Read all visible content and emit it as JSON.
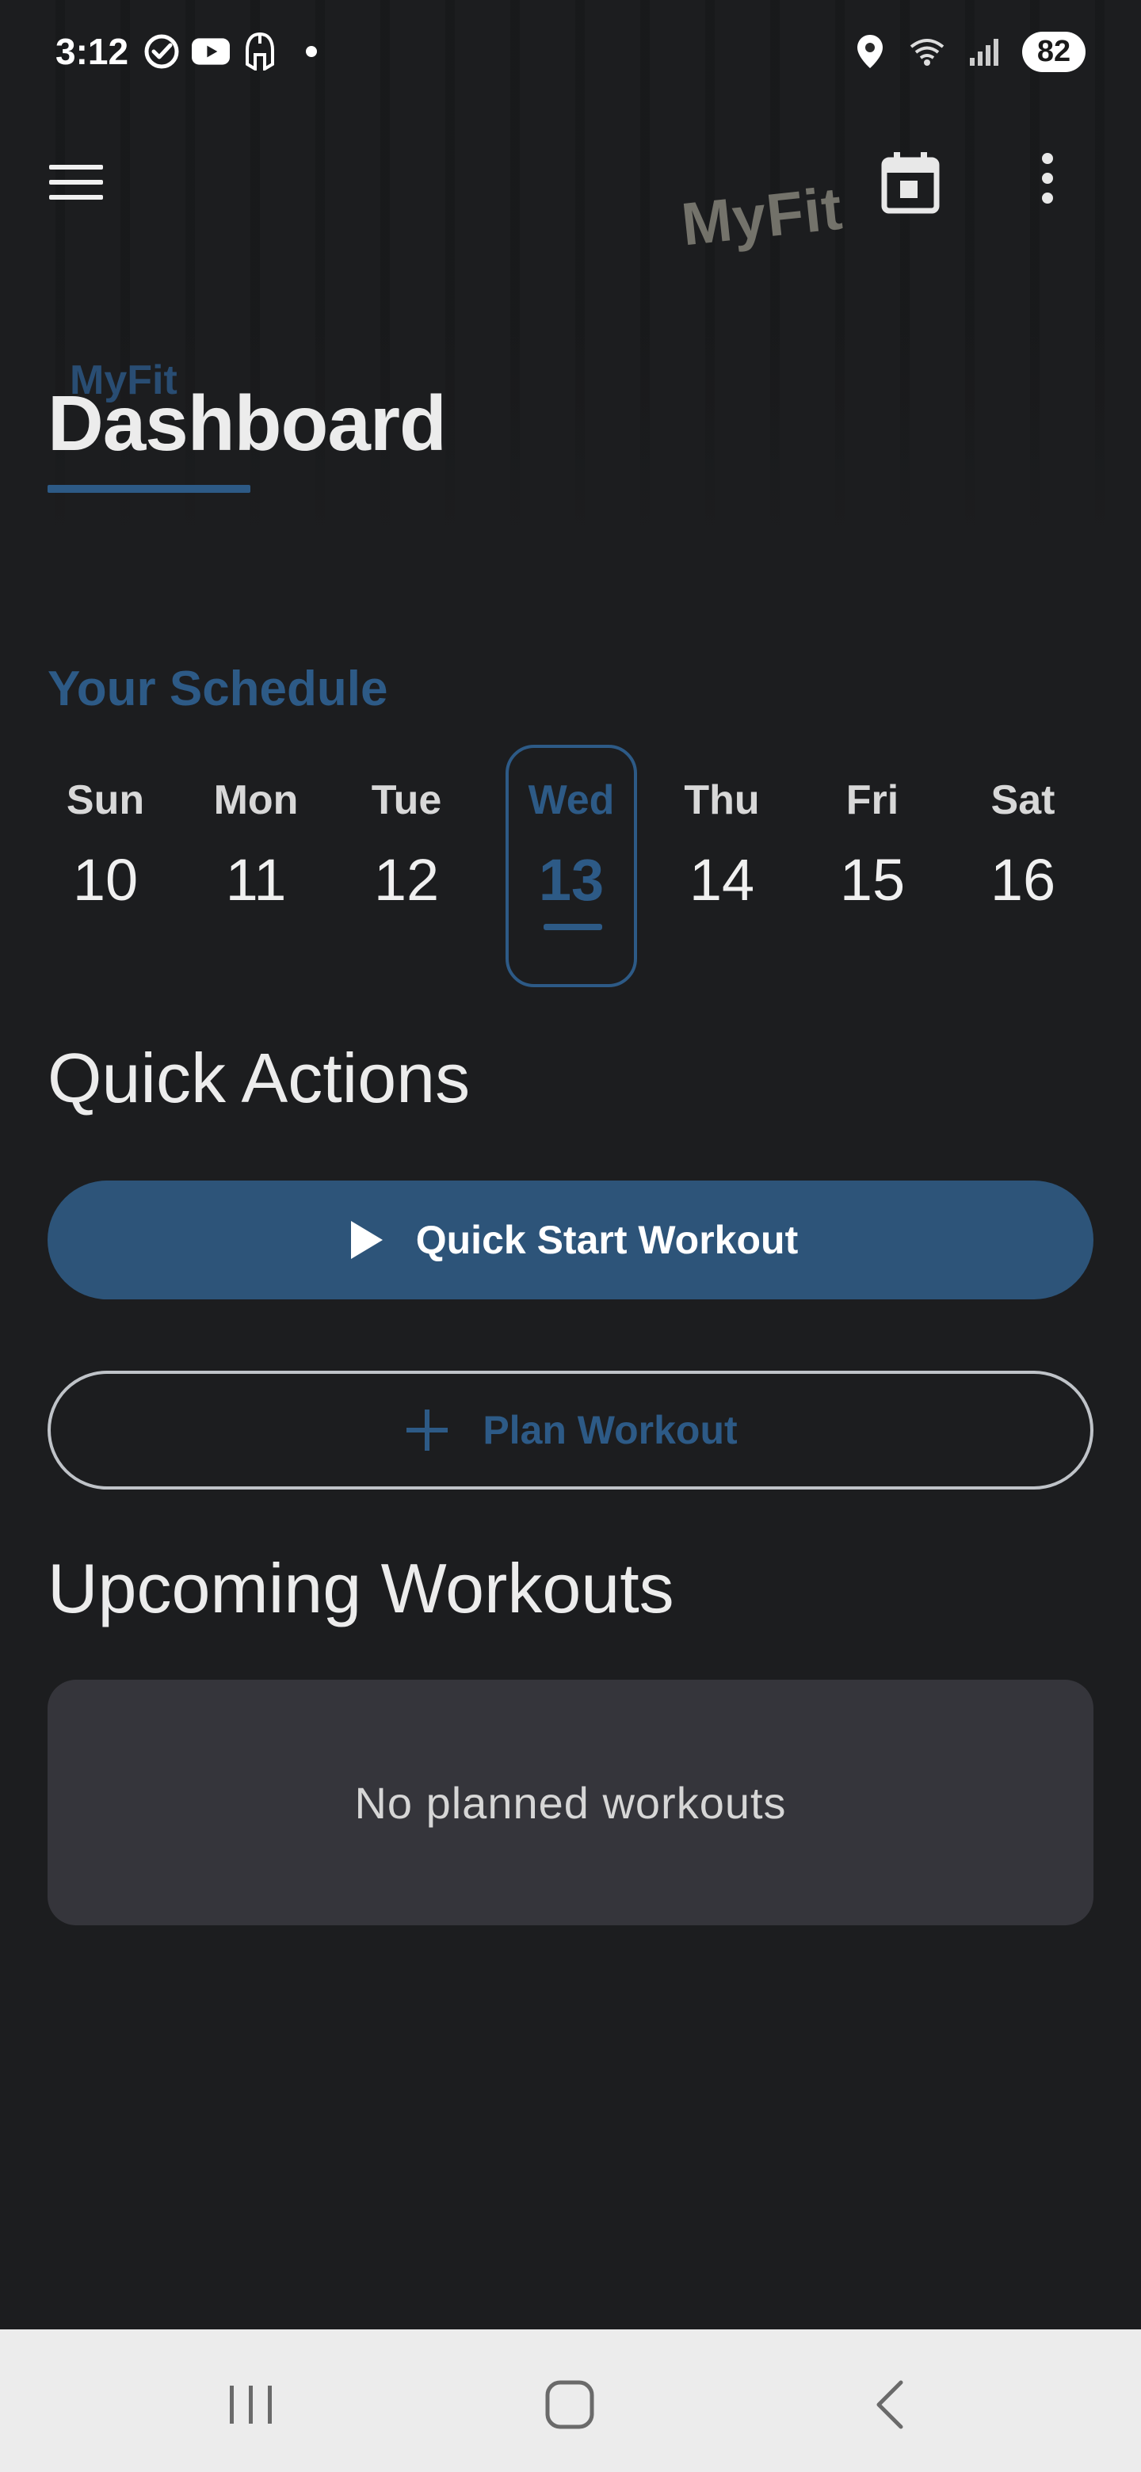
{
  "status_bar": {
    "time": "3:12",
    "battery": "82",
    "left_icons": [
      "check-circle-icon",
      "youtube-icon",
      "spartan-helmet-icon",
      "notification-dot-icon"
    ],
    "right_icons": [
      "location-icon",
      "wifi-icon",
      "signal-icon",
      "battery-icon"
    ]
  },
  "toolbar": {
    "menu_icon": "hamburger-menu-icon",
    "calendar_icon": "calendar-icon",
    "more_icon": "more-vert-icon"
  },
  "header": {
    "brand": "MyFit",
    "title": "Dashboard",
    "hero_sign": "MyFit"
  },
  "schedule": {
    "heading": "Your Schedule",
    "selected_index": 3,
    "days": [
      {
        "name": "Sun",
        "num": "10"
      },
      {
        "name": "Mon",
        "num": "11"
      },
      {
        "name": "Tue",
        "num": "12"
      },
      {
        "name": "Wed",
        "num": "13"
      },
      {
        "name": "Thu",
        "num": "14"
      },
      {
        "name": "Fri",
        "num": "15"
      },
      {
        "name": "Sat",
        "num": "16"
      }
    ]
  },
  "quick_actions": {
    "heading": "Quick Actions",
    "quick_start_label": "Quick Start Workout",
    "plan_label": "Plan Workout"
  },
  "upcoming": {
    "heading": "Upcoming Workouts",
    "empty_text": "No planned workouts"
  },
  "colors": {
    "accent": "#2d5a86",
    "primary_button": "#2d5479",
    "background": "#1c1d1f",
    "card": "#35353b"
  }
}
